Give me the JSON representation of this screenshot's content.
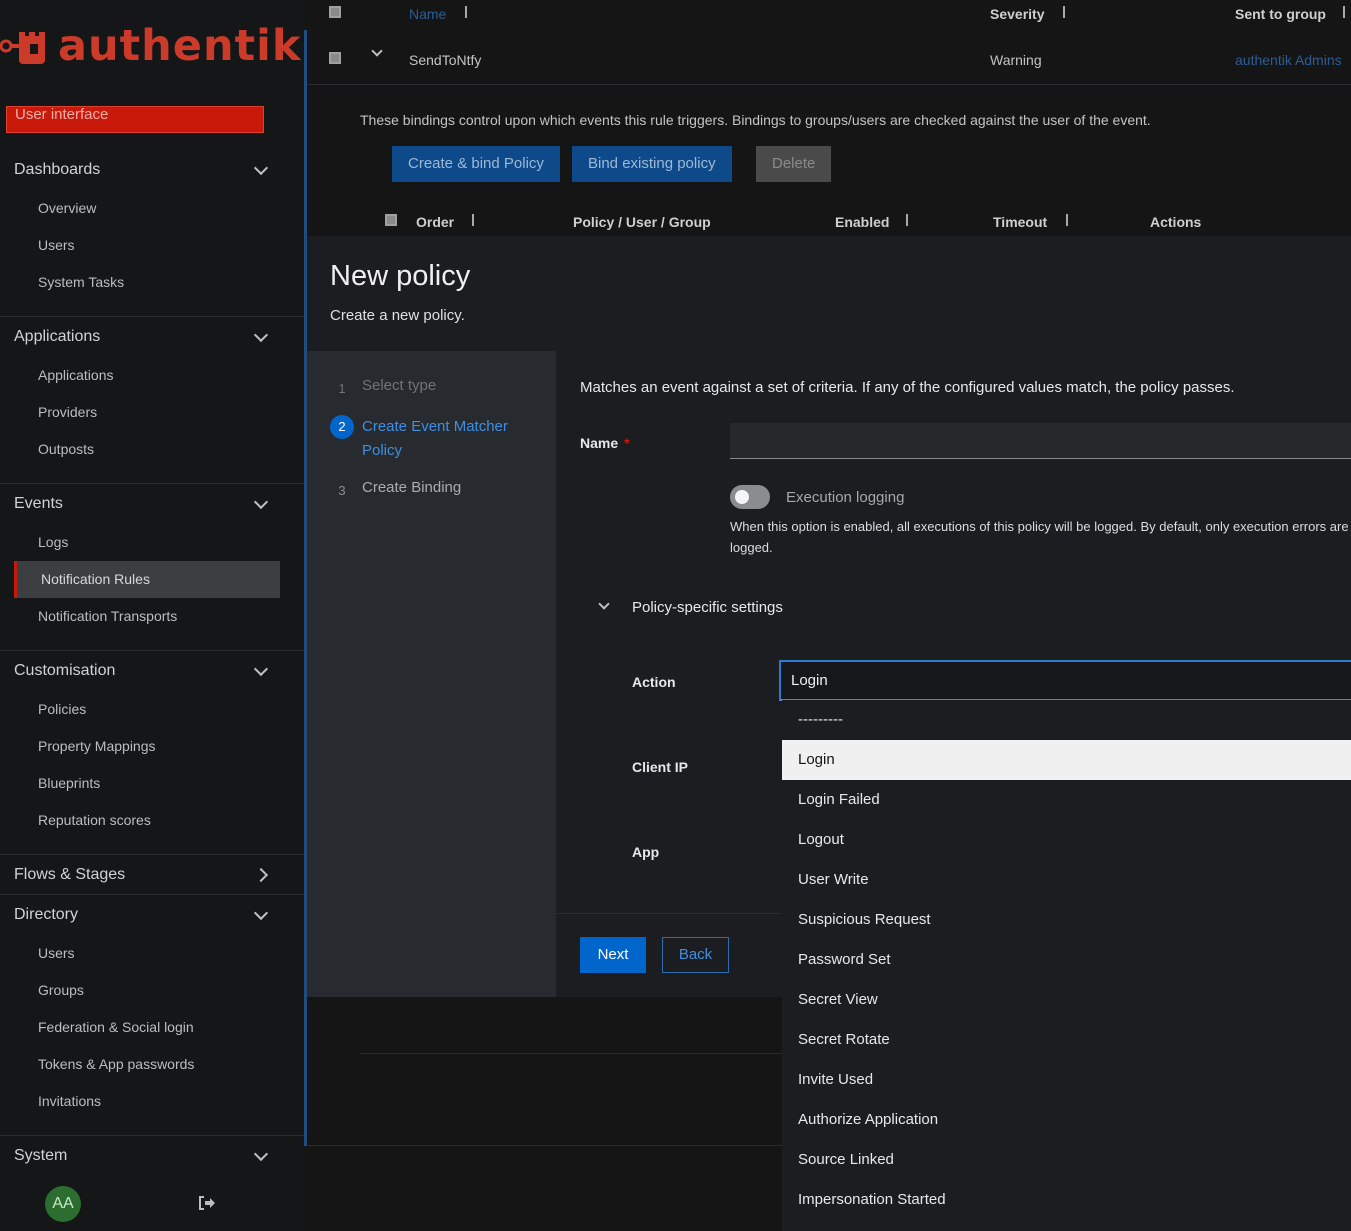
{
  "brand": {
    "name": "authentik"
  },
  "sidebar": {
    "user_interface_label": "User interface",
    "groups": [
      {
        "label": "Dashboards",
        "expanded": true,
        "items": [
          "Overview",
          "Users",
          "System Tasks"
        ]
      },
      {
        "label": "Applications",
        "expanded": true,
        "items": [
          "Applications",
          "Providers",
          "Outposts"
        ]
      },
      {
        "label": "Events",
        "expanded": true,
        "items": [
          "Logs",
          "Notification Rules",
          "Notification Transports"
        ]
      },
      {
        "label": "Customisation",
        "expanded": true,
        "items": [
          "Policies",
          "Property Mappings",
          "Blueprints",
          "Reputation scores"
        ]
      },
      {
        "label": "Flows & Stages",
        "expanded": false,
        "items": []
      },
      {
        "label": "Directory",
        "expanded": true,
        "items": [
          "Users",
          "Groups",
          "Federation & Social login",
          "Tokens & App passwords",
          "Invitations"
        ]
      },
      {
        "label": "System",
        "expanded": true,
        "items": []
      }
    ],
    "active_item": "Notification Rules",
    "avatar_initials": "AA"
  },
  "rules_table": {
    "headers": {
      "name": "Name",
      "severity": "Severity",
      "sent_to_group": "Sent to group"
    },
    "row": {
      "name": "SendToNtfy",
      "severity": "Warning",
      "group": "authentik Admins"
    },
    "bindings_help": "These bindings control upon which events this rule triggers. Bindings to groups/users are checked against the user of the event.",
    "buttons": {
      "create_bind": "Create & bind Policy",
      "bind_existing": "Bind existing policy",
      "delete": "Delete"
    },
    "binding_headers": {
      "order": "Order",
      "target": "Policy / User / Group",
      "enabled": "Enabled",
      "timeout": "Timeout",
      "actions": "Actions"
    }
  },
  "modal": {
    "title": "New policy",
    "subtitle": "Create a new policy.",
    "steps": [
      {
        "num": "1",
        "label": "Select type",
        "state": "done"
      },
      {
        "num": "2",
        "label": "Create Event Matcher Policy",
        "state": "current"
      },
      {
        "num": "3",
        "label": "Create Binding",
        "state": "pending"
      }
    ],
    "description": "Matches an event against a set of criteria. If any of the configured values match, the policy passes.",
    "name_label": "Name",
    "required_mark": "*",
    "name_value": "",
    "execution_logging_label": "Execution logging",
    "execution_logging_on": false,
    "execution_logging_help": "When this option is enabled, all executions of this policy will be logged. By default, only execution errors are logged.",
    "section_label": "Policy-specific settings",
    "action_label": "Action",
    "action_value": "Login",
    "client_ip_label": "Client IP",
    "app_label": "App",
    "next_label": "Next",
    "back_label": "Back"
  },
  "action_dropdown": {
    "options": [
      "---------",
      "Login",
      "Login Failed",
      "Logout",
      "User Write",
      "Suspicious Request",
      "Password Set",
      "Secret View",
      "Secret Rotate",
      "Invite Used",
      "Authorize Application",
      "Source Linked",
      "Impersonation Started"
    ],
    "selected": "Login"
  },
  "colors": {
    "accent": "#0066cc",
    "brand": "#cc3a2a",
    "danger": "#c9190b"
  }
}
